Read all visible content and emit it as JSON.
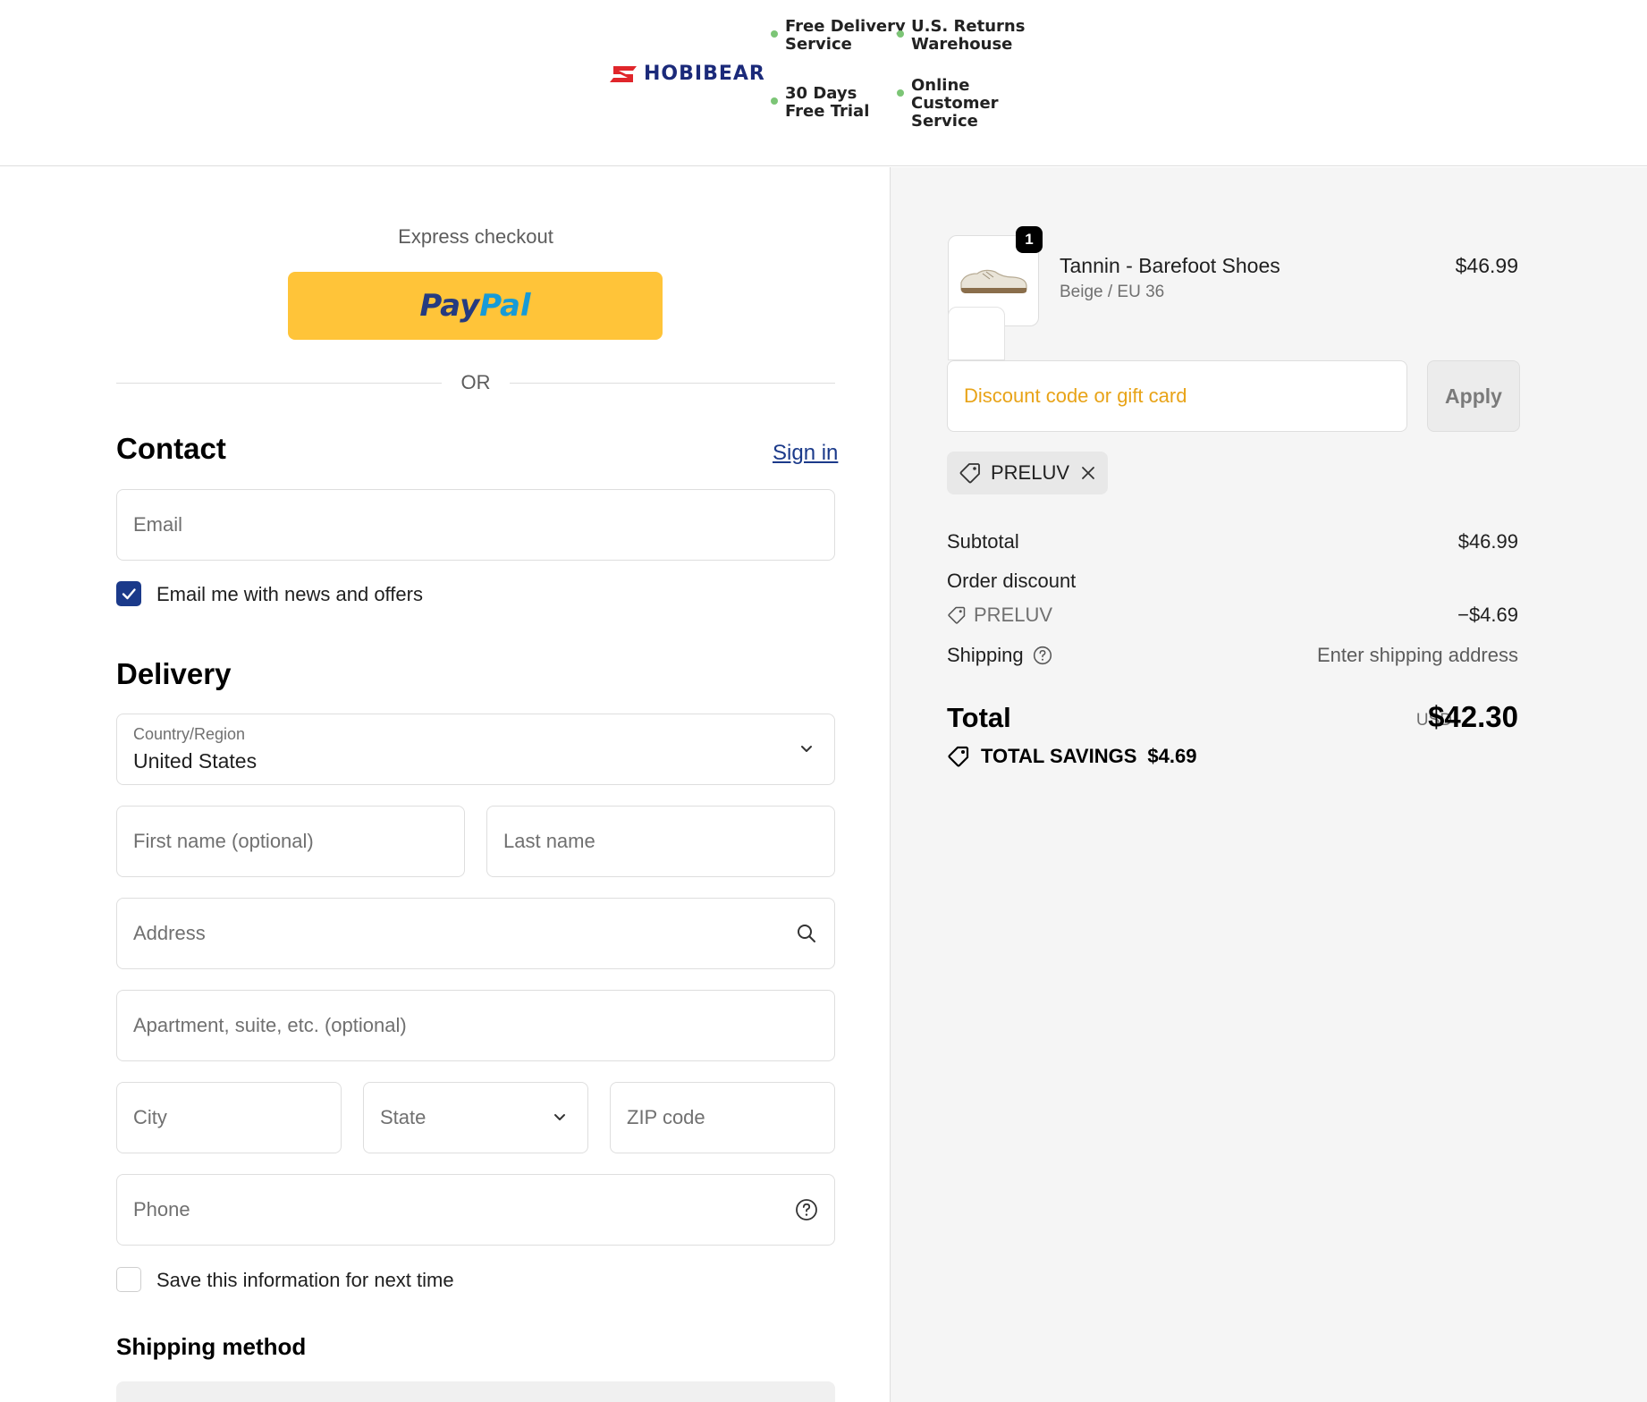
{
  "header": {
    "logo_text": "HOBIBEAR",
    "features": [
      "Free Delivery\nService",
      "U.S. Returns\nWarehouse",
      "30 Days\nFree Trial",
      "Online\nCustomer\nService"
    ],
    "feature_dot_color": "#7cc576"
  },
  "express": {
    "title": "Express checkout",
    "paypal_pay": "Pay",
    "paypal_pal": "Pal",
    "or": "OR"
  },
  "contact": {
    "heading": "Contact",
    "sign_in": "Sign in",
    "email_placeholder": "Email",
    "news_label": "Email me with news and offers",
    "news_checked": true
  },
  "delivery": {
    "heading": "Delivery",
    "country_label": "Country/Region",
    "country_value": "United States",
    "first_name": "First name (optional)",
    "last_name": "Last name",
    "address": "Address",
    "apartment": "Apartment, suite, etc. (optional)",
    "city": "City",
    "state": "State",
    "zip": "ZIP code",
    "phone": "Phone",
    "save_label": "Save this information for next time",
    "save_checked": false
  },
  "shipping_method": {
    "heading": "Shipping method"
  },
  "summary": {
    "item": {
      "quantity": "1",
      "name": "Tannin - Barefoot Shoes",
      "variant": "Beige / EU 36",
      "price": "$46.99"
    },
    "discount_placeholder": "Discount code or gift card",
    "apply_label": "Apply",
    "applied_code": "PRELUV",
    "subtotal_label": "Subtotal",
    "subtotal_value": "$46.99",
    "order_discount_label": "Order discount",
    "discount_code": "PRELUV",
    "discount_value": "−$4.69",
    "shipping_label": "Shipping",
    "shipping_value": "Enter shipping address",
    "total_label": "Total",
    "currency": "USD",
    "total_value": "$42.30",
    "savings_label": "TOTAL SAVINGS",
    "savings_value": "$4.69"
  },
  "colors": {
    "accent": "#1b3a8a",
    "paypal_yellow": "#ffc439",
    "discount_placeholder": "#e8a317",
    "logo": "#1b2a7a",
    "logo_red": "#e0262b"
  }
}
